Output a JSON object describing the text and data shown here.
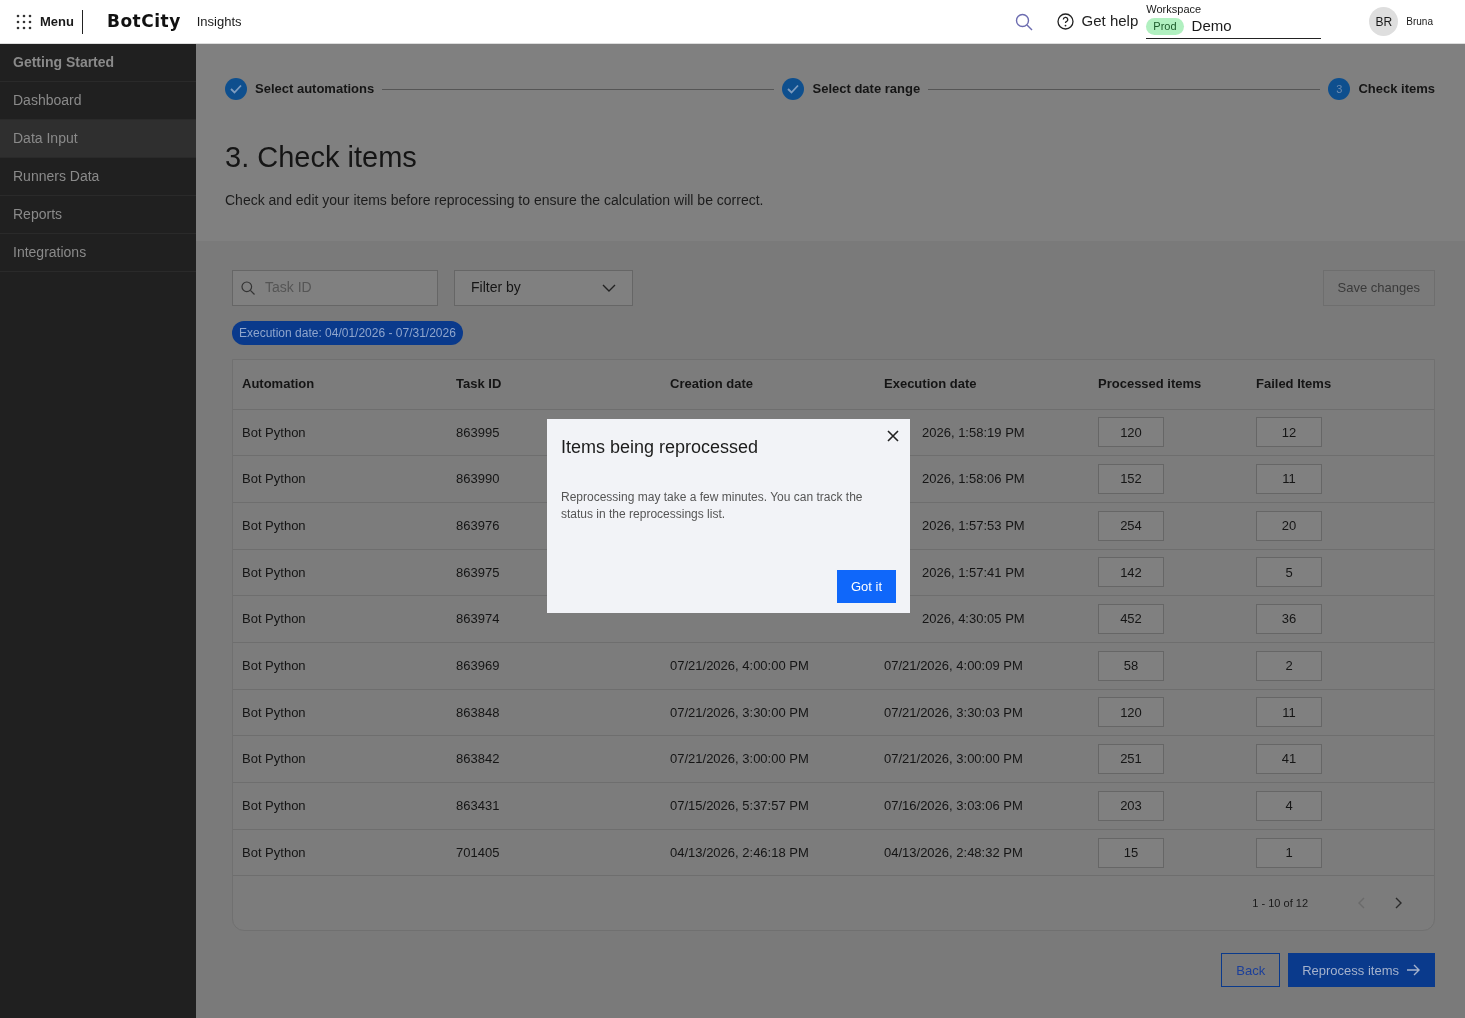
{
  "topbar": {
    "menu_label": "Menu",
    "logo": "BotCity",
    "product": "Insights",
    "help": "Get help",
    "workspace_label": "Workspace",
    "environment": "Prod",
    "workspace": "Demo",
    "avatar_initials": "BR",
    "user": "Bruna"
  },
  "sidebar": {
    "items": [
      {
        "label": "Getting Started",
        "kind": "heading",
        "selected": false
      },
      {
        "label": "Dashboard",
        "kind": "link",
        "selected": false
      },
      {
        "label": "Data Input",
        "kind": "link",
        "selected": true
      },
      {
        "label": "Runners Data",
        "kind": "link",
        "selected": false
      },
      {
        "label": "Reports",
        "kind": "link",
        "selected": false
      },
      {
        "label": "Integrations",
        "kind": "link",
        "selected": false
      }
    ]
  },
  "stepper": [
    {
      "label": "Select automations",
      "completed": true
    },
    {
      "label": "Select date range",
      "completed": true
    },
    {
      "label": "Check items",
      "number": "3",
      "completed": false
    }
  ],
  "page": {
    "title": "3. Check items",
    "description": "Check and edit your items before reprocessing to ensure the calculation will be correct."
  },
  "search": {
    "placeholder": "Task ID"
  },
  "filter": {
    "label": "Filter by"
  },
  "save_button": {
    "label": "Save changes",
    "disabled": true
  },
  "active_filters": [
    "Execution date: 04/01/2026 - 07/31/2026"
  ],
  "table": {
    "columns": [
      "Automation",
      "Task ID",
      "Creation date",
      "Execution date",
      "Processed items",
      "Failed Items"
    ],
    "rows": [
      {
        "automation": "Bot Python",
        "task_id": "863995",
        "execution_date": "2026, 1:58:19 PM",
        "processed": "120",
        "failed": "12"
      },
      {
        "automation": "Bot Python",
        "task_id": "863990",
        "execution_date": "2026, 1:58:06 PM",
        "processed": "152",
        "failed": "11"
      },
      {
        "automation": "Bot Python",
        "task_id": "863976",
        "execution_date": "2026, 1:57:53 PM",
        "processed": "254",
        "failed": "20"
      },
      {
        "automation": "Bot Python",
        "task_id": "863975",
        "execution_date": "2026, 1:57:41 PM",
        "processed": "142",
        "failed": "5"
      },
      {
        "automation": "Bot Python",
        "task_id": "863974",
        "execution_date": "2026, 4:30:05 PM",
        "processed": "452",
        "failed": "36"
      },
      {
        "automation": "Bot Python",
        "task_id": "863969",
        "creation_date": "07/21/2026, 4:00:00 PM",
        "execution_date": "07/21/2026, 4:00:09 PM",
        "processed": "58",
        "failed": "2"
      },
      {
        "automation": "Bot Python",
        "task_id": "863848",
        "creation_date": "07/21/2026, 3:30:00 PM",
        "execution_date": "07/21/2026, 3:30:03 PM",
        "processed": "120",
        "failed": "11"
      },
      {
        "automation": "Bot Python",
        "task_id": "863842",
        "creation_date": "07/21/2026, 3:00:00 PM",
        "execution_date": "07/21/2026, 3:00:00 PM",
        "processed": "251",
        "failed": "41"
      },
      {
        "automation": "Bot Python",
        "task_id": "863431",
        "creation_date": "07/15/2026, 5:37:57 PM",
        "execution_date": "07/16/2026, 3:03:06 PM",
        "processed": "203",
        "failed": "4"
      },
      {
        "automation": "Bot Python",
        "task_id": "701405",
        "creation_date": "04/13/2026, 2:46:18 PM",
        "execution_date": "04/13/2026, 2:48:32 PM",
        "processed": "15",
        "failed": "1"
      }
    ],
    "pagination": {
      "range": "1 - 10 of 12",
      "prev_disabled": true,
      "next_disabled": false
    }
  },
  "actions": {
    "back": "Back",
    "reprocess": "Reprocess items"
  },
  "modal": {
    "title": "Items being reprocessed",
    "message": "Reprocessing may take a few minutes. You can track the status in the reprocessings list.",
    "button": "Got it"
  }
}
